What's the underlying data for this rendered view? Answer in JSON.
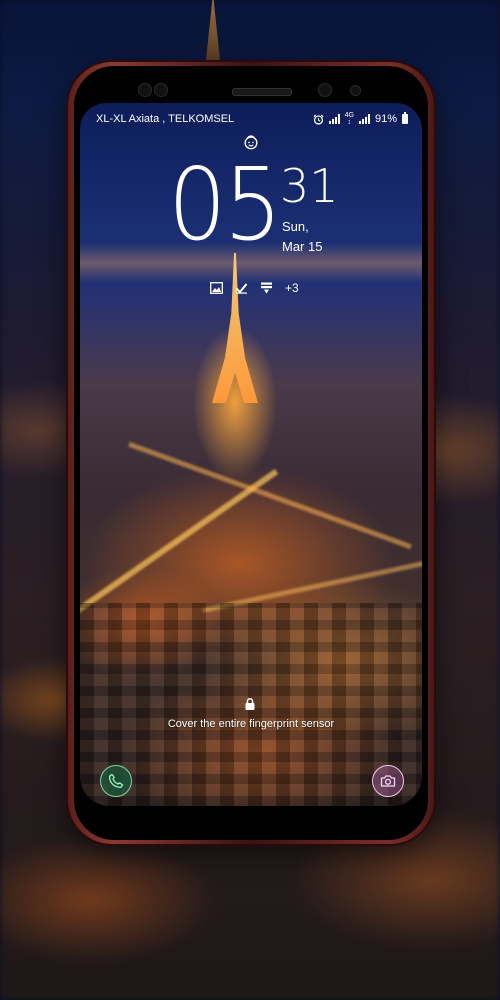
{
  "status_bar": {
    "carrier": "XL-XL Axiata , TELKOMSEL",
    "battery_percent": "91%",
    "icons": [
      "alarm-icon",
      "signal-icon",
      "4g-icon",
      "signal-icon",
      "battery-icon"
    ]
  },
  "clock": {
    "hours": "05",
    "minutes": "31",
    "day": "Sun,",
    "date": "Mar 15"
  },
  "notifications": {
    "icons": [
      "gallery-icon",
      "check-icon",
      "download-icon"
    ],
    "more": "+3"
  },
  "fingerprint_hint": "Cover the entire fingerprint sensor",
  "shortcuts": {
    "left": "phone-icon",
    "right": "camera-icon"
  },
  "colors": {
    "phone_accent": "#4fb884",
    "camera_accent": "#e8b0e0"
  }
}
